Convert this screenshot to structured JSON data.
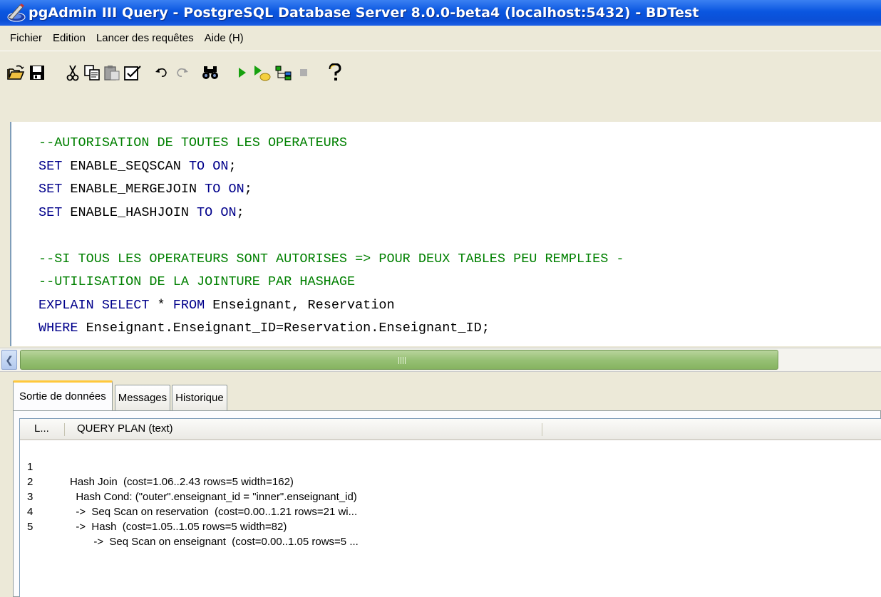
{
  "window": {
    "title": "pgAdmin III Query - PostgreSQL Database Server 8.0.0-beta4 (localhost:5432) - BDTest"
  },
  "menu": [
    "Fichier",
    "Edition",
    "Lancer des requêtes",
    "Aide (H)"
  ],
  "toolbar": {
    "buttons": [
      "open-icon",
      "save-icon",
      "cut-icon",
      "copy-icon",
      "paste-icon",
      "edit-icon",
      "undo-icon",
      "redo-icon",
      "find-icon",
      "execute-icon",
      "execute-to-file-icon",
      "explain-icon",
      "stop-icon",
      "help-icon"
    ]
  },
  "editor": {
    "lines": [
      "--AUTORISATION DE TOUTES LES OPERATEURS",
      "SET ENABLE_SEQSCAN TO ON;",
      "SET ENABLE_MERGEJOIN TO ON;",
      "SET ENABLE_HASHJOIN TO ON;",
      "",
      "--SI TOUS LES OPERATEURS SONT AUTORISES => POUR DEUX TABLES PEU REMPLIES -",
      "--UTILISATION DE LA JOINTURE PAR HASHAGE",
      "EXPLAIN SELECT * FROM Enseignant, Reservation",
      "WHERE Enseignant.Enseignant_ID=Reservation.Enseignant_ID;"
    ]
  },
  "output": {
    "tabs": [
      "Sortie de données",
      "Messages",
      "Historique"
    ],
    "active_tab": "Sortie de données",
    "columns": [
      "L...",
      "QUERY PLAN (text)"
    ],
    "rows": [
      {
        "n": "1",
        "plan": "Hash Join  (cost=1.06..2.43 rows=5 width=162)"
      },
      {
        "n": "2",
        "plan": "  Hash Cond: (\"outer\".enseignant_id = \"inner\".enseignant_id)"
      },
      {
        "n": "3",
        "plan": "  ->  Seq Scan on reservation  (cost=0.00..1.21 rows=21 wi..."
      },
      {
        "n": "4",
        "plan": "  ->  Hash  (cost=1.05..1.05 rows=5 width=82)"
      },
      {
        "n": "5",
        "plan": "        ->  Seq Scan on enseignant  (cost=0.00..1.05 rows=5 ..."
      }
    ]
  },
  "scrollbar": {
    "grip": "III"
  },
  "colors": {
    "comment": "#008000",
    "keyword": "#00008b",
    "titlebar": "#0a56e0",
    "active_tab_accent": "#ffc83c"
  }
}
